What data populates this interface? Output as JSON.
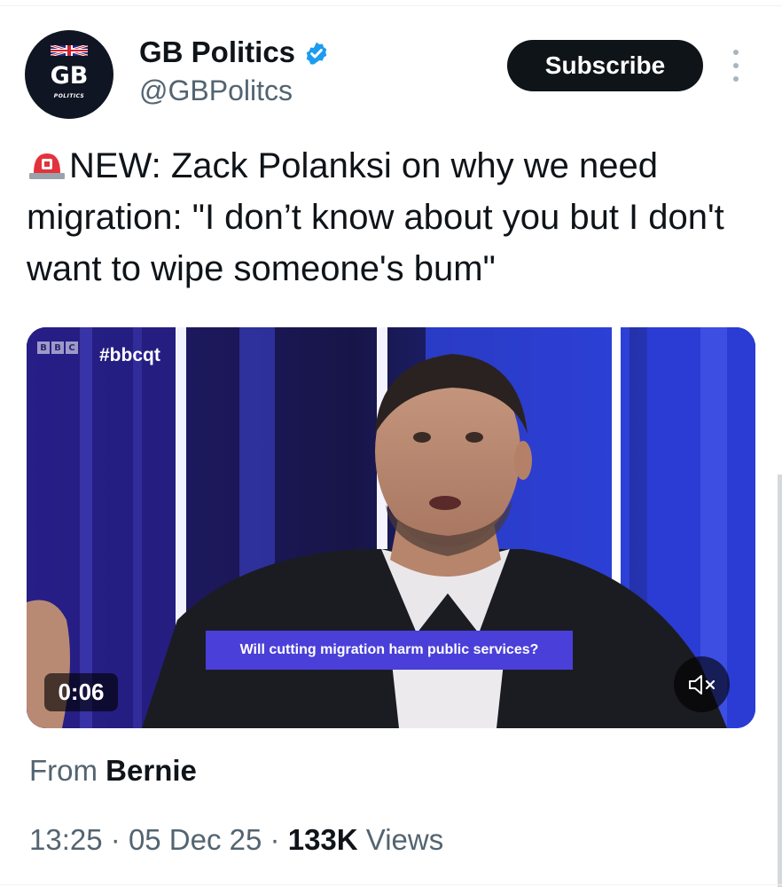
{
  "account": {
    "display_name": "GB Politics",
    "handle": "@GBPolitcs",
    "avatar_text": "GB",
    "avatar_subtext": "POLITICS",
    "verified": true
  },
  "actions": {
    "subscribe_label": "Subscribe",
    "more_icon": "more-vertical-icon"
  },
  "tweet": {
    "emoji": "siren-icon",
    "text": "NEW: Zack Polanksi on why we need migration: \"I don’t know about you but I don't want to wipe someone's bum\""
  },
  "video": {
    "channel_logo": [
      "B",
      "B",
      "C"
    ],
    "hashtag": "#bbcqt",
    "caption": "Will cutting migration harm public services?",
    "duration": "0:06",
    "mute_icon": "volume-muted-icon"
  },
  "source": {
    "prefix": "From",
    "name": "Bernie"
  },
  "meta": {
    "time": "13:25",
    "separator": "·",
    "date": "05 Dec 25",
    "views_count": "133K",
    "views_label": "Views"
  },
  "colors": {
    "text_primary": "#0f1419",
    "text_secondary": "#536471",
    "verified_blue": "#1d9bf0",
    "button_dark": "#0f1419",
    "caption_purple": "#4a3fd8",
    "studio_blue": "#2a3ee0"
  }
}
